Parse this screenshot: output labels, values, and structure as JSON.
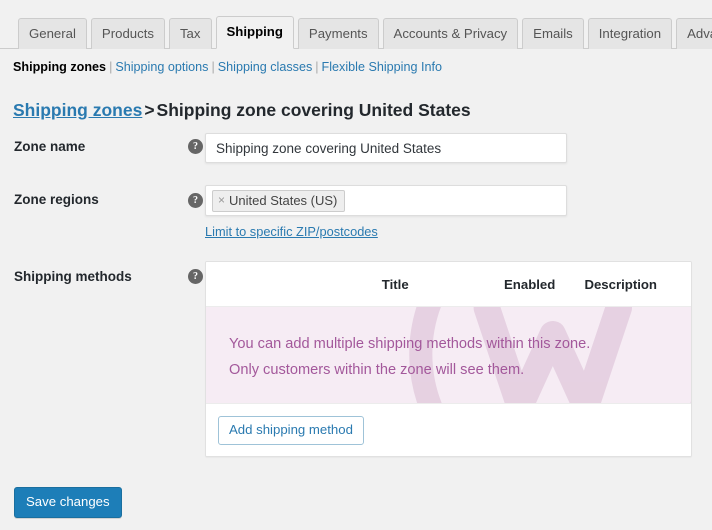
{
  "tabs": [
    {
      "label": "General",
      "active": false
    },
    {
      "label": "Products",
      "active": false
    },
    {
      "label": "Tax",
      "active": false
    },
    {
      "label": "Shipping",
      "active": true
    },
    {
      "label": "Payments",
      "active": false
    },
    {
      "label": "Accounts & Privacy",
      "active": false
    },
    {
      "label": "Emails",
      "active": false
    },
    {
      "label": "Integration",
      "active": false
    },
    {
      "label": "Advanced",
      "active": false
    }
  ],
  "subnav": {
    "current": "Shipping zones",
    "links": [
      "Shipping options",
      "Shipping classes",
      "Flexible Shipping Info"
    ],
    "separator": "|"
  },
  "heading": {
    "link": "Shipping zones",
    "separator": ">",
    "title": "Shipping zone covering United States"
  },
  "form": {
    "zone_name": {
      "label": "Zone name",
      "help_icon": "help-icon",
      "help_glyph": "?",
      "value": "Shipping zone covering United States",
      "placeholder": "Zone name"
    },
    "zone_regions": {
      "label": "Zone regions",
      "help_icon": "help-icon",
      "help_glyph": "?",
      "chips": [
        {
          "remove_glyph": "×",
          "label": "United States (US)"
        }
      ],
      "limit_link": "Limit to specific ZIP/postcodes"
    },
    "shipping_methods": {
      "label": "Shipping methods",
      "help_icon": "help-icon",
      "help_glyph": "?",
      "columns": [
        "",
        "Title",
        "Enabled",
        "Description"
      ],
      "empty_message_line1": "You can add multiple shipping methods within this zone.",
      "empty_message_line2": "Only customers within the zone will see them.",
      "add_button": "Add shipping method"
    }
  },
  "footer": {
    "save_label": "Save changes"
  },
  "colors": {
    "page_bg": "#f1f1f1",
    "link": "#2a7ab0",
    "primary_button": "#1d7eb8",
    "empty_bg": "#f6ecf4",
    "empty_text": "#a3589b",
    "tab_bg": "#e5e5e5",
    "tab_border": "#cccccc"
  }
}
